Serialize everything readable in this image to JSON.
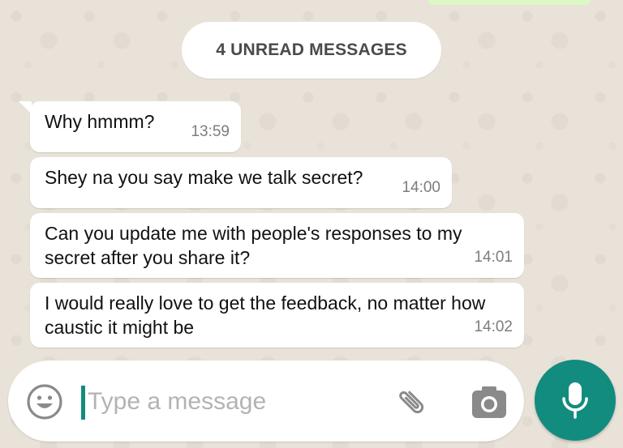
{
  "unread_banner": {
    "text": "4 UNREAD MESSAGES"
  },
  "messages": [
    {
      "text": "Why hmmm?",
      "time": "13:59"
    },
    {
      "text": "Shey na you say make we talk secret?",
      "time": "14:00"
    },
    {
      "text": "Can you update me with people's responses to my secret after you share it?",
      "time": "14:01"
    },
    {
      "text": "I would really love to get the feedback, no matter how caustic it might be",
      "time": "14:02"
    }
  ],
  "composer": {
    "placeholder": "Type a message",
    "emoji_icon": "smiley-icon",
    "attach_icon": "paperclip-icon",
    "camera_icon": "camera-icon",
    "mic_icon": "microphone-icon"
  },
  "colors": {
    "accent": "#128c7e",
    "background": "#ece5dd",
    "bubble": "#ffffff",
    "sent_bubble": "#dcf8c6"
  }
}
